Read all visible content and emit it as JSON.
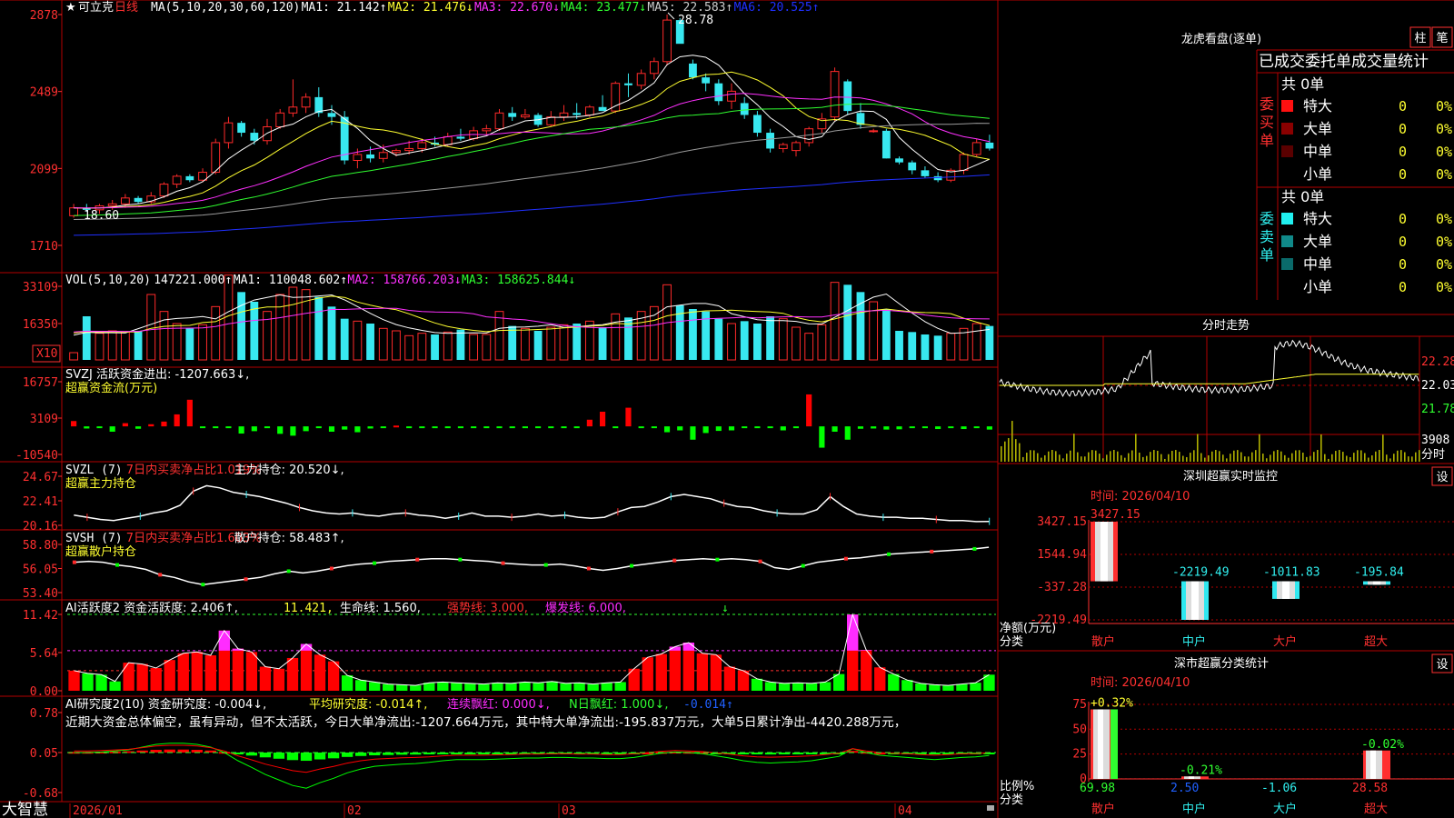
{
  "app": {
    "brand": "大智慧"
  },
  "colors": {
    "up": "#ff2a2a",
    "down": "#38e8f0",
    "grid": "#b40000",
    "ma1": "#ffffff",
    "ma2": "#ffff30",
    "ma3": "#ff30ff",
    "ma4": "#30ff30",
    "ma5": "#9a9a9a",
    "ma6": "#2030ff",
    "pos": "#ff0000",
    "neg": "#00ff00",
    "magenta": "#ff2cff"
  },
  "k": {
    "star": "★",
    "name": "可立克",
    "period": "日线",
    "ma_header": "MA(5,10,20,30,60,120)",
    "legend": [
      {
        "label": "MA1: 21.142",
        "arrow": "↑",
        "color": "#ffffff"
      },
      {
        "label": "MA2: 21.476",
        "arrow": "↓",
        "color": "#ffff30"
      },
      {
        "label": "MA3: 22.670",
        "arrow": "↓",
        "color": "#ff30ff"
      },
      {
        "label": "MA4: 23.477",
        "arrow": "↓",
        "color": "#30ff30"
      },
      {
        "label": "MA5: 22.583",
        "arrow": "↑",
        "color": "#cccccc"
      },
      {
        "label": "MA6: 20.525",
        "arrow": "↑",
        "color": "#2030ff"
      }
    ],
    "yticks": [
      "2878",
      "2489",
      "2099",
      "1710"
    ],
    "high_mark": "28.78",
    "low_mark": "18.60",
    "x_labels": [
      "2026/01",
      "02",
      "03",
      "04"
    ]
  },
  "vol": {
    "header": "VOL(5,10,20)",
    "legend": [
      {
        "label": "147221.000",
        "arrow": "↑",
        "color": "#ffffff"
      },
      {
        "label": "MA1: 110048.602",
        "arrow": "↑",
        "color": "#ffffff"
      },
      {
        "label": "MA2: 158766.203",
        "arrow": "↓",
        "color": "#ff30ff"
      },
      {
        "label": "MA3: 158625.844",
        "arrow": "↓",
        "color": "#30ff30"
      }
    ],
    "yticks": [
      "33109",
      "16350"
    ],
    "unit": "X10"
  },
  "svzj": {
    "line1": "SVZJ  活跃资金进出: -1207.663↓,",
    "line2": "超赢资金流(万元)",
    "yticks": [
      "16757",
      "3109",
      "-10540"
    ]
  },
  "svzl": {
    "head": "SVZL (7)",
    "pct": "7日内买卖净占比1.019%",
    "tail": "主力持仓: 20.520↓,",
    "line2": "超赢主力持仓",
    "yticks": [
      "24.67",
      "22.41",
      "20.16"
    ]
  },
  "svsh": {
    "head": "SVSH (7)",
    "pct": "7日内买卖净占比1.603%",
    "tail": "散户持仓: 58.483↑,",
    "line2": "超赢散户持仓",
    "yticks": [
      "58.80",
      "56.05",
      "53.40"
    ]
  },
  "ai1": {
    "head": "AI活跃度2 资金活跃度: 2.406↑,",
    "v2": "11.421,",
    "v3": "生命线: 1.560,",
    "v4": "强势线: 3.000,",
    "v5": "爆发线: 6.000,",
    "yticks": [
      "11.42",
      "5.64",
      "0.00"
    ]
  },
  "ai2": {
    "head": "AI研究度2(10) 资金研究度: -0.004↓,",
    "v2": "平均研究度: -0.014↑,",
    "v3": "连续飘红: 0.000↓,",
    "v4": "N日飘红: 1.000↓,",
    "v5": "-0.014↑",
    "summary": "近期大资金总体偏空，虽有异动，但不太活跃，今日大单净流出:-1207.664万元，其中特大单净流出:-195.837万元，大单5日累计净出-4420.288万元，",
    "yticks": [
      "0.78",
      "0.05",
      "-0.68"
    ]
  },
  "lhb": {
    "title": "龙虎看盘(逐单)",
    "btn1": "柱",
    "btn2": "笔",
    "sub": "已成交委托单成交量统计",
    "buy_side": "委买单",
    "sell_side": "委卖单",
    "buy_total": "共 0单",
    "sell_total": "共 0单",
    "buy_rows": [
      {
        "label": "特大",
        "value": "0",
        "pct": "0%",
        "color": "#ff1010"
      },
      {
        "label": "大单",
        "value": "0",
        "pct": "0%",
        "color": "#8a0000"
      },
      {
        "label": "中单",
        "value": "0",
        "pct": "0%",
        "color": "#5a0000"
      },
      {
        "label": "小单",
        "value": "0",
        "pct": "0%",
        "color": ""
      }
    ],
    "sell_rows": [
      {
        "label": "特大",
        "value": "0",
        "pct": "0%",
        "color": "#20f0f0"
      },
      {
        "label": "大单",
        "value": "0",
        "pct": "0%",
        "color": "#108a8a"
      },
      {
        "label": "中单",
        "value": "0",
        "pct": "0%",
        "color": "#0a6a6a"
      },
      {
        "label": "小单",
        "value": "0",
        "pct": "0%",
        "color": ""
      }
    ]
  },
  "fs": {
    "title": "分时走势",
    "yticks": [
      "22.28",
      "22.03",
      "21.78"
    ],
    "vol_tick": "3908",
    "vol_unit": "分时"
  },
  "monitor": {
    "title": "深圳超赢实时监控",
    "btn": "设",
    "time": "时间: 2026/04/10",
    "yticks": [
      "3427.15",
      "1544.94",
      "-337.28",
      "-2219.49"
    ],
    "ylabel1": "净额(万元)",
    "ylabel2": "分类",
    "cats": [
      "散户",
      "中户",
      "大户",
      "超大"
    ],
    "values": [
      3427.15,
      -2219.49,
      -1011.83,
      -195.84
    ],
    "labels": [
      "3427.15",
      "-2219.49",
      "-1011.83",
      "-195.84"
    ]
  },
  "cls": {
    "title": "深市超赢分类统计",
    "btn": "设",
    "time": "时间: 2026/04/10",
    "yticks": [
      "75",
      "50",
      "25",
      "0"
    ],
    "ylabel1": "比例%",
    "ylabel2": "分类",
    "cats": [
      "散户",
      "中户",
      "大户",
      "超大"
    ],
    "bar_top": [
      "+0.32%",
      "-0.21%",
      "",
      "-0.02%"
    ],
    "bottom_vals": [
      "69.98",
      "2.50",
      "-1.06",
      "28.58"
    ],
    "ratios": [
      69.98,
      2.5,
      0,
      28.58
    ]
  },
  "chart_data": [
    {
      "type": "candlestick",
      "title": "可立克 日线",
      "ylim": [
        17.1,
        28.78
      ],
      "x_labels": [
        "2026/01",
        "02",
        "03",
        "04"
      ],
      "candles": [
        [
          18.6,
          19.2,
          18.5,
          19.0
        ],
        [
          19.0,
          19.2,
          18.8,
          18.9
        ],
        [
          18.9,
          19.2,
          18.7,
          19.1
        ],
        [
          19.1,
          19.4,
          18.9,
          19.2
        ],
        [
          19.2,
          19.7,
          19.0,
          19.5
        ],
        [
          19.5,
          19.6,
          19.2,
          19.3
        ],
        [
          19.3,
          19.8,
          19.2,
          19.6
        ],
        [
          19.6,
          20.3,
          19.5,
          20.2
        ],
        [
          20.2,
          20.7,
          20.0,
          20.6
        ],
        [
          20.6,
          20.7,
          20.3,
          20.4
        ],
        [
          20.4,
          21.0,
          20.3,
          20.8
        ],
        [
          20.8,
          22.5,
          20.7,
          22.3
        ],
        [
          22.3,
          23.6,
          22.0,
          23.3
        ],
        [
          23.3,
          23.4,
          22.6,
          22.8
        ],
        [
          22.8,
          23.0,
          22.2,
          22.4
        ],
        [
          22.4,
          23.5,
          22.2,
          23.1
        ],
        [
          23.1,
          24.0,
          23.0,
          23.8
        ],
        [
          23.8,
          25.5,
          23.6,
          24.1
        ],
        [
          24.1,
          24.8,
          23.8,
          24.6
        ],
        [
          24.6,
          25.1,
          23.6,
          23.8
        ],
        [
          23.8,
          24.2,
          23.2,
          23.6
        ],
        [
          23.6,
          23.9,
          21.2,
          21.4
        ],
        [
          21.4,
          22.0,
          21.0,
          21.7
        ],
        [
          21.7,
          22.1,
          21.3,
          21.5
        ],
        [
          21.5,
          22.2,
          21.3,
          21.8
        ],
        [
          21.8,
          22.0,
          21.6,
          21.9
        ],
        [
          21.9,
          22.4,
          21.7,
          22.0
        ],
        [
          22.0,
          22.5,
          21.8,
          22.3
        ],
        [
          22.3,
          22.6,
          22.1,
          22.2
        ],
        [
          22.2,
          22.8,
          22.1,
          22.6
        ],
        [
          22.6,
          23.0,
          22.4,
          22.5
        ],
        [
          22.5,
          23.1,
          22.4,
          22.9
        ],
        [
          22.9,
          23.2,
          22.7,
          23.0
        ],
        [
          23.0,
          24.0,
          22.9,
          23.8
        ],
        [
          23.8,
          24.1,
          23.4,
          23.6
        ],
        [
          23.6,
          24.0,
          23.5,
          23.7
        ],
        [
          23.7,
          23.8,
          23.1,
          23.2
        ],
        [
          23.2,
          23.9,
          23.1,
          23.6
        ],
        [
          23.6,
          24.2,
          23.4,
          23.8
        ],
        [
          23.8,
          24.3,
          23.5,
          23.7
        ],
        [
          23.7,
          24.2,
          23.6,
          24.1
        ],
        [
          24.1,
          24.7,
          23.9,
          23.9
        ],
        [
          23.9,
          25.4,
          23.8,
          25.3
        ],
        [
          25.3,
          25.8,
          24.6,
          25.2
        ],
        [
          25.2,
          26.0,
          25.0,
          25.8
        ],
        [
          25.8,
          26.6,
          25.5,
          26.4
        ],
        [
          26.4,
          28.78,
          26.2,
          28.5
        ],
        [
          28.5,
          28.6,
          27.5,
          27.3
        ],
        [
          26.3,
          26.5,
          25.5,
          25.6
        ],
        [
          25.6,
          25.8,
          24.9,
          25.3
        ],
        [
          25.3,
          25.5,
          24.2,
          24.4
        ],
        [
          24.4,
          25.3,
          24.0,
          24.9
        ],
        [
          24.3,
          24.6,
          23.5,
          23.7
        ],
        [
          23.7,
          23.9,
          22.6,
          22.8
        ],
        [
          22.8,
          23.0,
          21.8,
          22.0
        ],
        [
          22.0,
          22.3,
          21.8,
          22.2
        ],
        [
          21.9,
          22.4,
          21.6,
          22.3
        ],
        [
          22.3,
          23.1,
          22.1,
          23.0
        ],
        [
          23.0,
          23.8,
          22.8,
          23.5
        ],
        [
          23.6,
          26.1,
          23.4,
          25.9
        ],
        [
          25.4,
          25.5,
          23.7,
          23.9
        ],
        [
          23.8,
          24.3,
          23.0,
          23.2
        ],
        [
          22.9,
          23.0,
          22.8,
          22.9
        ],
        [
          22.9,
          23.0,
          21.5,
          21.5
        ],
        [
          21.5,
          21.6,
          21.2,
          21.3
        ],
        [
          21.3,
          21.4,
          20.7,
          20.9
        ],
        [
          20.9,
          21.1,
          20.5,
          20.6
        ],
        [
          20.6,
          20.8,
          20.3,
          20.4
        ],
        [
          20.4,
          21.0,
          20.3,
          20.9
        ],
        [
          20.9,
          21.8,
          20.7,
          21.7
        ],
        [
          21.7,
          22.5,
          21.6,
          22.3
        ],
        [
          22.3,
          22.7,
          21.9,
          22.0
        ]
      ],
      "ma_values": {
        "MA1": 21.142,
        "MA2": 21.476,
        "MA3": 22.67,
        "MA4": 23.477,
        "MA5": 22.583,
        "MA6": 20.525
      }
    },
    {
      "type": "bar",
      "title": "VOL(5,10,20)",
      "unit": "X10",
      "ylim": [
        0,
        33109
      ],
      "values": [
        3000,
        18000,
        11000,
        12000,
        11500,
        12000,
        27000,
        20000,
        15000,
        13000,
        14500,
        22000,
        35000,
        28000,
        24000,
        20000,
        27000,
        30000,
        29000,
        26000,
        22000,
        17000,
        16000,
        15000,
        13000,
        12000,
        10000,
        11000,
        10500,
        11500,
        12500,
        10500,
        10500,
        20000,
        14000,
        13000,
        12000,
        13500,
        14500,
        15000,
        16000,
        13500,
        19000,
        17500,
        20000,
        22000,
        31000,
        22500,
        21000,
        20000,
        17000,
        15000,
        16000,
        15000,
        18000,
        17000,
        13500,
        11000,
        14500,
        32000,
        31000,
        28000,
        24000,
        21000,
        12000,
        11500,
        10500,
        10000,
        11000,
        13000,
        15000,
        14000
      ],
      "ma_values": {
        "VOL": 147221.0,
        "MA1": 110048.602,
        "MA2": 158766.203,
        "MA3": 158625.844
      }
    },
    {
      "type": "bar",
      "title": "超赢资金流(万元)",
      "ylim": [
        -10540,
        16757
      ],
      "values": [
        2000,
        -800,
        -500,
        -2000,
        1200,
        -900,
        800,
        1800,
        4500,
        10000,
        -300,
        -200,
        -300,
        -2700,
        -1800,
        -200,
        -2800,
        -3500,
        -1800,
        -200,
        -2000,
        -1200,
        -2200,
        -800,
        -500,
        300,
        -400,
        -200,
        -600,
        -400,
        -200,
        -400,
        -500,
        -600,
        -500,
        -500,
        -600,
        -400,
        -500,
        -400,
        2500,
        5500,
        -500,
        7000,
        -500,
        -400,
        -2200,
        -1500,
        -5000,
        -2500,
        -1700,
        -1500,
        -500,
        -200,
        -500,
        -1500,
        -200,
        12000,
        -8000,
        -2000,
        -5000,
        -900,
        -800,
        -1200,
        -1100,
        -300,
        -200,
        -1000,
        -200,
        -1000,
        -500,
        -1207.663
      ],
      "series_value": -1207.663
    },
    {
      "type": "line",
      "title": "超赢主力持仓",
      "ylim": [
        20.16,
        24.67
      ],
      "values": [
        21.1,
        20.9,
        20.7,
        20.6,
        20.8,
        21.0,
        21.3,
        21.5,
        22.0,
        23.3,
        23.8,
        23.6,
        23.2,
        23.0,
        22.8,
        22.5,
        22.2,
        21.8,
        21.5,
        21.3,
        21.2,
        21.3,
        21.1,
        21.0,
        21.2,
        21.3,
        21.1,
        21.0,
        20.8,
        21.0,
        21.3,
        21.0,
        21.0,
        20.9,
        21.0,
        21.2,
        21.0,
        21.1,
        20.9,
        20.8,
        20.9,
        21.4,
        21.8,
        21.9,
        22.3,
        22.8,
        23.0,
        22.8,
        22.6,
        22.2,
        21.9,
        21.8,
        21.5,
        21.3,
        21.2,
        21.2,
        21.6,
        22.8,
        21.9,
        21.2,
        21.0,
        20.9,
        20.9,
        20.8,
        20.8,
        20.7,
        20.6,
        20.6,
        20.5,
        20.52
      ],
      "series_value": 20.52,
      "ratio_7d": "1.019%"
    },
    {
      "type": "line",
      "title": "超赢散户持仓",
      "ylim": [
        53.4,
        58.8
      ],
      "values": [
        56.8,
        56.9,
        56.8,
        56.5,
        56.3,
        56.0,
        55.4,
        55.1,
        54.6,
        54.3,
        54.5,
        54.7,
        54.9,
        55.1,
        55.5,
        55.8,
        55.6,
        55.8,
        56.1,
        56.4,
        56.6,
        56.7,
        56.9,
        57.0,
        57.1,
        57.2,
        57.2,
        57.1,
        57.0,
        56.9,
        56.7,
        56.6,
        56.5,
        56.5,
        56.6,
        56.4,
        56.1,
        55.9,
        56.1,
        56.4,
        56.6,
        56.8,
        57.0,
        57.1,
        57.2,
        57.1,
        57.2,
        57.1,
        56.9,
        56.2,
        56.0,
        56.4,
        56.8,
        57.0,
        57.2,
        57.3,
        57.5,
        57.7,
        57.8,
        57.9,
        58.0,
        58.1,
        58.2,
        58.3,
        58.483
      ],
      "series_value": 58.483,
      "ratio_7d": "1.603%"
    },
    {
      "type": "bar",
      "title": "AI活跃度2",
      "ylim": [
        0,
        11.42
      ],
      "values": [
        3.0,
        2.6,
        2.4,
        1.4,
        4.2,
        4.0,
        3.4,
        4.6,
        5.6,
        5.8,
        5.3,
        9.0,
        6.3,
        5.8,
        3.6,
        3.3,
        4.9,
        7.0,
        5.4,
        4.4,
        2.3,
        1.6,
        1.3,
        1.0,
        0.9,
        0.8,
        1.2,
        1.3,
        1.2,
        1.1,
        1.0,
        1.2,
        1.1,
        1.3,
        1.2,
        1.4,
        1.1,
        1.2,
        1.0,
        1.2,
        1.3,
        3.3,
        5.0,
        5.5,
        6.6,
        7.2,
        5.6,
        5.4,
        3.6,
        3.0,
        1.8,
        1.3,
        1.1,
        1.2,
        1.1,
        1.3,
        2.5,
        11.4,
        6.1,
        3.5,
        2.5,
        1.6,
        1.1,
        0.9,
        0.8,
        1.0,
        1.2,
        2.406
      ],
      "thresholds": {
        "life": 1.56,
        "strong": 3.0,
        "burst": 6.0
      }
    },
    {
      "type": "line",
      "title": "AI研究度2(10)",
      "ylim": [
        -0.68,
        0.78
      ],
      "values": [
        0.05,
        0.05,
        0.06,
        0.08,
        0.1,
        0.15,
        0.2,
        0.22,
        0.22,
        0.2,
        0.15,
        0.05,
        -0.1,
        -0.22,
        -0.35,
        -0.45,
        -0.55,
        -0.6,
        -0.5,
        -0.42,
        -0.32,
        -0.25,
        -0.2,
        -0.18,
        -0.16,
        -0.15,
        -0.13,
        -0.1,
        -0.08,
        -0.08,
        -0.08,
        -0.07,
        -0.06,
        -0.05,
        -0.05,
        -0.04,
        -0.04,
        -0.05,
        -0.05,
        -0.06,
        -0.06,
        -0.04,
        0.0,
        0.04,
        0.06,
        0.05,
        0.03,
        -0.01,
        -0.05,
        -0.1,
        -0.13,
        -0.14,
        -0.13,
        -0.12,
        -0.1,
        -0.06,
        -0.02,
        0.12,
        0.05,
        0.0,
        -0.02,
        -0.04,
        -0.06,
        -0.08,
        -0.06,
        -0.04,
        -0.03,
        -0.004
      ],
      "series_value": -0.004,
      "avg": -0.014
    },
    {
      "type": "bar",
      "title": "深圳超赢实时监控",
      "categories": [
        "散户",
        "中户",
        "大户",
        "超大"
      ],
      "values": [
        3427.15,
        -2219.49,
        -1011.83,
        -195.84
      ],
      "ylabel": "净额(万元)"
    },
    {
      "type": "bar",
      "title": "深市超赢分类统计",
      "categories": [
        "散户",
        "中户",
        "大户",
        "超大"
      ],
      "values": [
        69.98,
        2.5,
        -1.06,
        28.58
      ],
      "changes": [
        "+0.32%",
        "-0.21%",
        "",
        "-0.02%"
      ],
      "ylabel": "比例%",
      "ylim": [
        0,
        75
      ]
    }
  ]
}
